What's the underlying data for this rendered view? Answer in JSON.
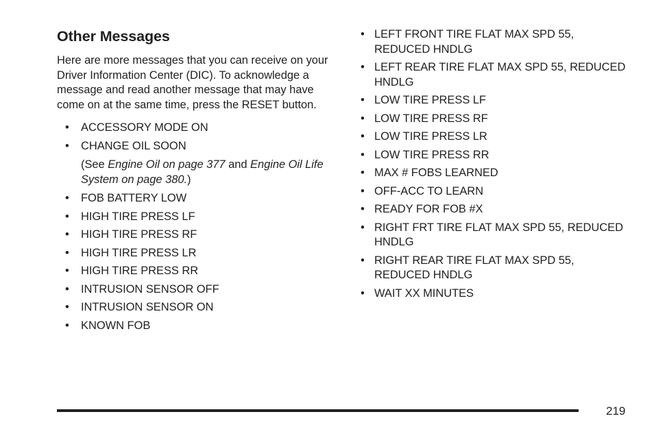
{
  "document": {
    "page_number": "219",
    "section_heading": "Other Messages",
    "intro_paragraph": "Here are more messages that you can receive on your Driver Information Center (DIC). To acknowledge a message and read another message that may have come on at the same time, press the RESET button.",
    "bullet_glyph": "•"
  },
  "left_column": {
    "items_before_note": [
      {
        "text": "ACCESSORY MODE ON"
      },
      {
        "text": "CHANGE OIL SOON"
      }
    ],
    "note": {
      "prefix": "(See ",
      "ref1": "Engine Oil on page 377",
      "middle": " and ",
      "ref2": "Engine Oil Life System on page 380.",
      "suffix": ")"
    },
    "items_after_note": [
      {
        "text": "FOB BATTERY LOW"
      },
      {
        "text": "HIGH TIRE PRESS LF"
      },
      {
        "text": "HIGH TIRE PRESS RF"
      },
      {
        "text": "HIGH TIRE PRESS LR"
      },
      {
        "text": "HIGH TIRE PRESS RR"
      },
      {
        "text": "INTRUSION SENSOR OFF"
      },
      {
        "text": "INTRUSION SENSOR ON"
      },
      {
        "text": "KNOWN FOB"
      }
    ]
  },
  "right_column": {
    "items": [
      {
        "text": "LEFT FRONT TIRE FLAT MAX SPD 55, REDUCED HNDLG"
      },
      {
        "text": "LEFT REAR TIRE FLAT MAX SPD 55, REDUCED HNDLG"
      },
      {
        "text": "LOW TIRE PRESS LF"
      },
      {
        "text": "LOW TIRE PRESS RF"
      },
      {
        "text": "LOW TIRE PRESS LR"
      },
      {
        "text": "LOW TIRE PRESS RR"
      },
      {
        "text": "MAX # FOBS LEARNED"
      },
      {
        "text": "OFF-ACC TO LEARN"
      },
      {
        "text": "READY FOR FOB #X"
      },
      {
        "text": "RIGHT FRT TIRE FLAT MAX SPD 55, REDUCED HNDLG"
      },
      {
        "text": "RIGHT REAR TIRE FLAT MAX SPD 55, REDUCED HNDLG"
      },
      {
        "text": "WAIT XX MINUTES"
      }
    ]
  },
  "colors": {
    "text": "#231f20",
    "background": "#ffffff",
    "rule": "#231f20"
  }
}
